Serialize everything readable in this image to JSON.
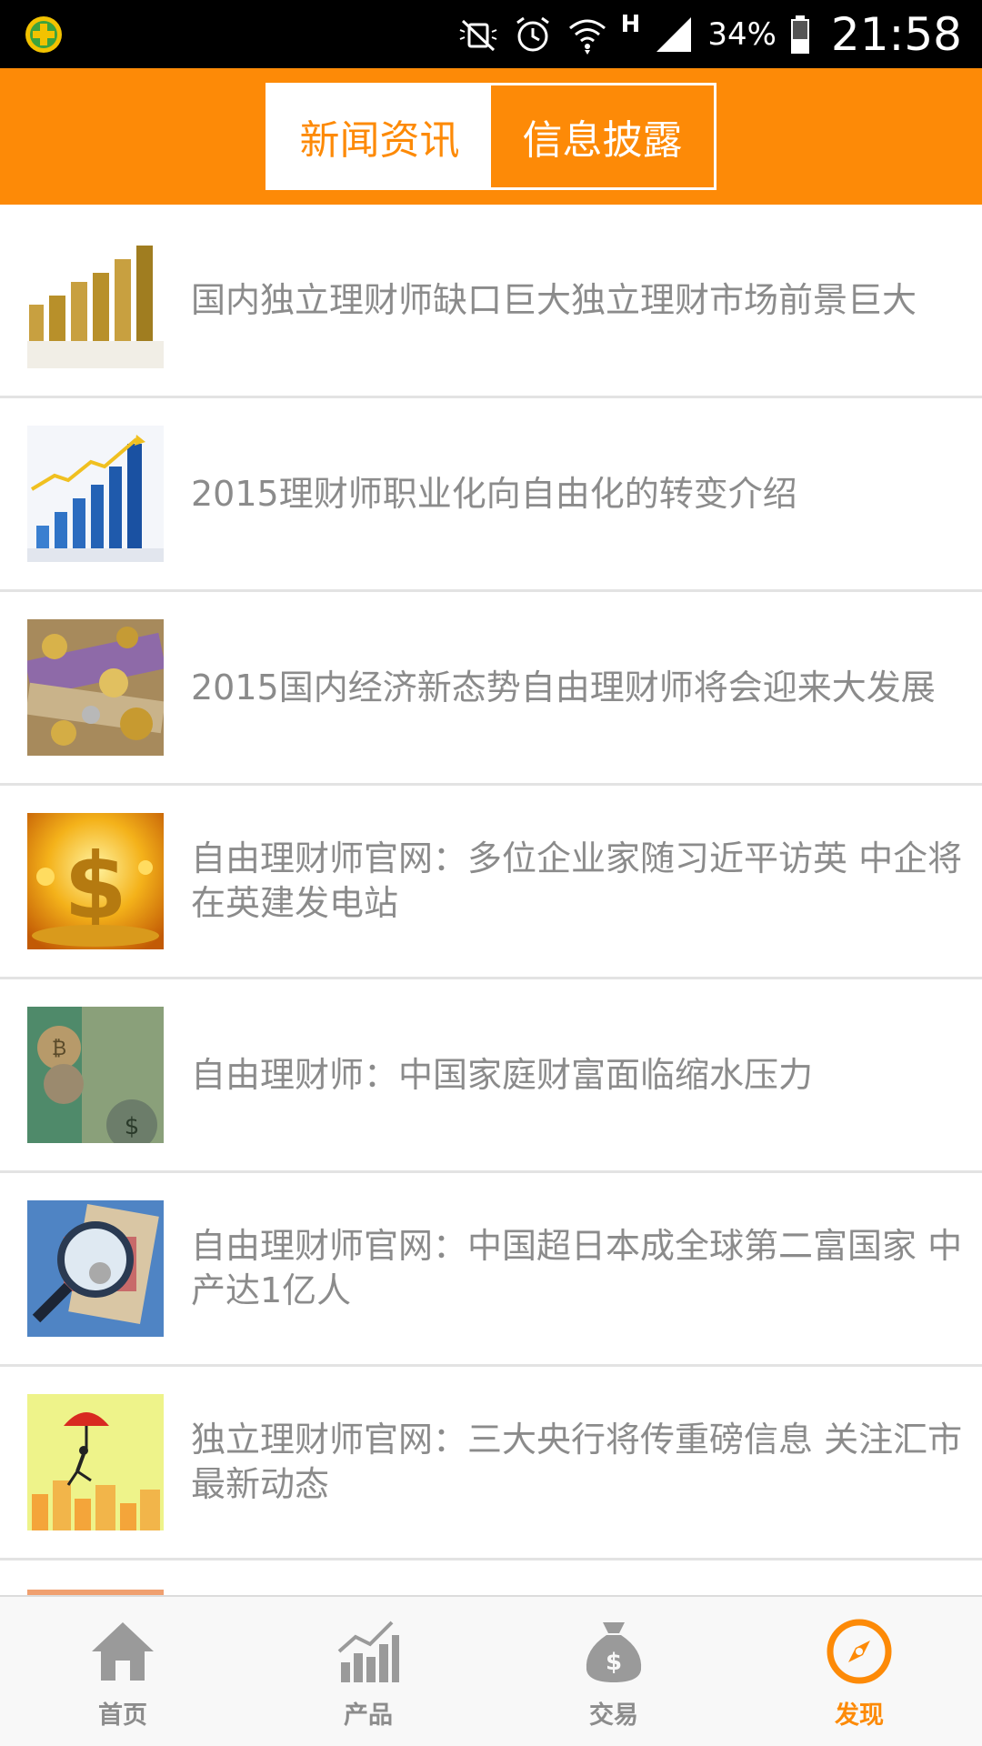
{
  "status_bar": {
    "battery_percent": "34%",
    "time": "21:58",
    "network_type": "H",
    "icons": [
      "app-shield-icon",
      "mute-icon",
      "alarm-icon",
      "wifi-icon",
      "signal-icon",
      "battery-icon"
    ]
  },
  "header": {
    "tabs": [
      {
        "label": "新闻资讯",
        "active": true
      },
      {
        "label": "信息披露",
        "active": false
      }
    ]
  },
  "news": [
    {
      "title": "国内独立理财师缺口巨大独立理财市场前景巨大",
      "thumb": "coin-stacks"
    },
    {
      "title": "2015理财师职业化向自由化的转变介绍",
      "thumb": "bar-growth"
    },
    {
      "title": "2015国内经济新态势自由理财师将会迎来大发展",
      "thumb": "banknotes-coins"
    },
    {
      "title": "自由理财师官网：多位企业家随习近平访英 中企将在英建发电站",
      "thumb": "gold-dollar"
    },
    {
      "title": "自由理财师：中国家庭财富面临缩水压力",
      "thumb": "bitcoin-coins"
    },
    {
      "title": "自由理财师官网：中国超日本成全球第二富国家 中产达1亿人",
      "thumb": "magnifier-money"
    },
    {
      "title": "独立理财师官网：三大央行将传重磅信息 关注汇市最新动态",
      "thumb": "umbrella-man"
    }
  ],
  "bottom_nav": [
    {
      "label": "首页",
      "icon": "home-icon",
      "active": false
    },
    {
      "label": "产品",
      "icon": "chart-icon",
      "active": false
    },
    {
      "label": "交易",
      "icon": "money-bag-icon",
      "active": false
    },
    {
      "label": "发现",
      "icon": "compass-icon",
      "active": true
    }
  ],
  "colors": {
    "accent": "#fd8a07",
    "text_gray": "#8b8b8b",
    "divider": "#e3e3e3"
  }
}
